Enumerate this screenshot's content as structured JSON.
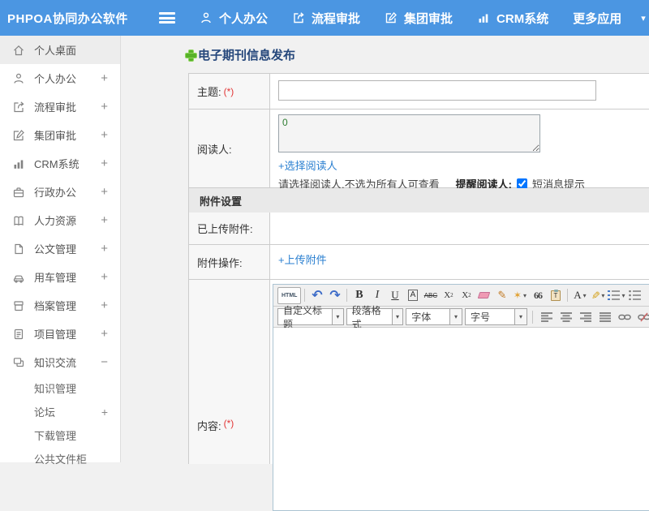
{
  "app": {
    "title": "PHPOA协同办公软件"
  },
  "topnav": {
    "items": [
      {
        "label": "个人办公",
        "icon": "person-icon"
      },
      {
        "label": "流程审批",
        "icon": "flow-icon"
      },
      {
        "label": "集团审批",
        "icon": "edit-square-icon"
      },
      {
        "label": "CRM系统",
        "icon": "bar-chart-icon"
      },
      {
        "label": "更多应用",
        "icon": ""
      }
    ],
    "caret": "▾"
  },
  "sidebar": {
    "items": [
      {
        "label": "个人桌面",
        "toggle": "",
        "icon": "home-icon"
      },
      {
        "label": "个人办公",
        "toggle": "+",
        "icon": "person-icon"
      },
      {
        "label": "流程审批",
        "toggle": "+",
        "icon": "flow-icon"
      },
      {
        "label": "集团审批",
        "toggle": "+",
        "icon": "edit-square-icon"
      },
      {
        "label": "CRM系统",
        "toggle": "+",
        "icon": "bar-chart-icon"
      },
      {
        "label": "行政办公",
        "toggle": "+",
        "icon": "briefcase-icon"
      },
      {
        "label": "人力资源",
        "toggle": "+",
        "icon": "book-icon"
      },
      {
        "label": "公文管理",
        "toggle": "+",
        "icon": "document-icon"
      },
      {
        "label": "用车管理",
        "toggle": "+",
        "icon": "car-icon"
      },
      {
        "label": "档案管理",
        "toggle": "+",
        "icon": "archive-icon"
      },
      {
        "label": "项目管理",
        "toggle": "+",
        "icon": "clipboard-icon"
      },
      {
        "label": "知识交流",
        "toggle": "−",
        "icon": "chat-icon"
      }
    ],
    "subitems": [
      {
        "label": "知识管理",
        "toggle": ""
      },
      {
        "label": "论坛",
        "toggle": "+"
      },
      {
        "label": "下载管理",
        "toggle": ""
      },
      {
        "label": "公共文件柜",
        "toggle": ""
      }
    ]
  },
  "page": {
    "title": "电子期刊信息发布"
  },
  "form": {
    "subject_label": "主题:",
    "required_mark": "(*)",
    "readers_label": "阅读人:",
    "readers_value": "0",
    "select_readers_link": "+选择阅读人",
    "readers_hint": "请选择阅读人,不选为所有人可查看",
    "remind_label": "提醒阅读人:",
    "sms_label": "短消息提示",
    "sms_checked": "checked",
    "attach_section_title": "附件设置",
    "uploaded_label": "已上传附件:",
    "attach_ops_label": "附件操作:",
    "upload_link": "+上传附件",
    "content_label": "内容:",
    "content_required": "(*)"
  },
  "editor": {
    "html_label": "HTML",
    "undo_glyph": "↶",
    "redo_glyph": "↷",
    "bold": "B",
    "italic": "I",
    "underline": "U",
    "boxed_a": "A",
    "strike": "ABC",
    "sup_base": "X",
    "sup_exp": "2",
    "sub_base": "X",
    "sub_exp": "2",
    "brush_glyph": "✎",
    "wand_glyph": "✶",
    "quote": "66",
    "clip_letter": "T",
    "fontcolor": "A",
    "hl_glyph": "✎",
    "caret": "▾",
    "selects": [
      {
        "label": "自定义标题"
      },
      {
        "label": "段落格式"
      },
      {
        "label": "字体"
      },
      {
        "label": "字号"
      }
    ]
  },
  "colors": {
    "topbar": "#4b96e2",
    "title_text": "#25477b",
    "link": "#2a7fd0",
    "required": "#e23535",
    "section_bg": "#e9e9e9",
    "readers_value_text": "#2e7d32"
  }
}
